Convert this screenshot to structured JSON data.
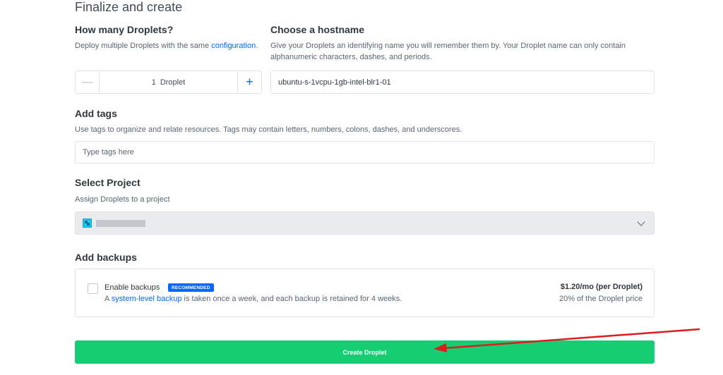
{
  "page": {
    "title": "Finalize and create"
  },
  "droplets": {
    "heading": "How many Droplets?",
    "desc_prefix": "Deploy multiple Droplets with the same ",
    "desc_link": "configuration",
    "desc_suffix": ".",
    "minus": "—",
    "count": "1",
    "unit": "Droplet",
    "plus": "+"
  },
  "hostname": {
    "heading": "Choose a hostname",
    "desc": "Give your Droplets an identifying name you will remember them by. Your Droplet name can only contain alphanumeric characters, dashes, and periods.",
    "value": "ubuntu-s-1vcpu-1gb-intel-blr1-01"
  },
  "tags": {
    "heading": "Add tags",
    "desc": "Use tags to organize and relate resources. Tags may contain letters, numbers, colons, dashes, and underscores.",
    "placeholder": "Type tags here"
  },
  "project": {
    "heading": "Select Project",
    "desc": "Assign Droplets to a project"
  },
  "backups": {
    "heading": "Add backups",
    "label": "Enable backups",
    "badge": "RECOMMENDED",
    "desc_prefix": "A ",
    "desc_link": "system-level backup",
    "desc_suffix": " is taken once a week, and each backup is retained for 4 weeks.",
    "price": "$1.20/mo (per Droplet)",
    "price_sub": "20% of the Droplet price",
    "checked": false
  },
  "actions": {
    "create_label": "Create Droplet"
  },
  "colors": {
    "primary": "#0069ff",
    "create": "#15cd72",
    "annotation": "#e01b1b"
  }
}
